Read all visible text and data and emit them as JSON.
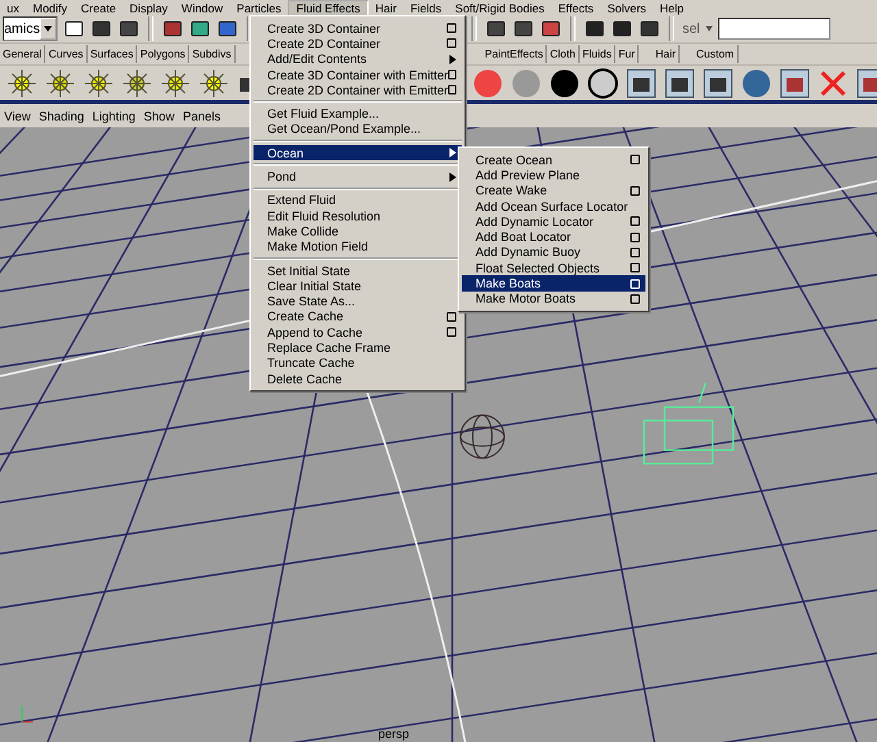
{
  "menu_bar": [
    {
      "label": "ux",
      "selected": false
    },
    {
      "label": "Modify",
      "selected": false
    },
    {
      "label": "Create",
      "selected": false
    },
    {
      "label": "Display",
      "selected": false
    },
    {
      "label": "Window",
      "selected": false
    },
    {
      "label": "Particles",
      "selected": false
    },
    {
      "label": "Fluid Effects",
      "selected": true
    },
    {
      "label": "Hair",
      "selected": false
    },
    {
      "label": "Fields",
      "selected": false
    },
    {
      "label": "Soft/Rigid Bodies",
      "selected": false
    },
    {
      "label": "Effects",
      "selected": false
    },
    {
      "label": "Solvers",
      "selected": false
    },
    {
      "label": "Help",
      "selected": false
    }
  ],
  "status_line": {
    "menu_set": "amics",
    "selection_mode": "sel"
  },
  "shelf_tabs": [
    "General",
    "Curves",
    "Surfaces",
    "Polygons",
    "Subdivs",
    "PaintEffects",
    "Cloth",
    "Fluids",
    "Fur",
    "Hair",
    "Custom"
  ],
  "panel_menu": [
    "View",
    "Shading",
    "Lighting",
    "Show",
    "Panels"
  ],
  "fluid_effects_menu": [
    [
      {
        "label": "Create 3D Container",
        "option_box": true,
        "submenu": false,
        "highlighted": false
      },
      {
        "label": "Create 2D Container",
        "option_box": true,
        "submenu": false,
        "highlighted": false
      },
      {
        "label": "Add/Edit Contents",
        "option_box": false,
        "submenu": true,
        "highlighted": false
      },
      {
        "label": "Create 3D Container with Emitter",
        "option_box": true,
        "submenu": false,
        "highlighted": false
      },
      {
        "label": "Create 2D Container with Emitter",
        "option_box": true,
        "submenu": false,
        "highlighted": false
      }
    ],
    [
      {
        "label": "Get Fluid Example...",
        "option_box": false,
        "submenu": false,
        "highlighted": false
      },
      {
        "label": "Get Ocean/Pond Example...",
        "option_box": false,
        "submenu": false,
        "highlighted": false
      }
    ],
    [
      {
        "label": "Ocean",
        "option_box": false,
        "submenu": true,
        "highlighted": true
      }
    ],
    [
      {
        "label": "Pond",
        "option_box": false,
        "submenu": true,
        "highlighted": false
      }
    ],
    [
      {
        "label": "Extend Fluid",
        "option_box": false,
        "submenu": false,
        "highlighted": false
      },
      {
        "label": "Edit Fluid Resolution",
        "option_box": false,
        "submenu": false,
        "highlighted": false
      },
      {
        "label": "Make Collide",
        "option_box": false,
        "submenu": false,
        "highlighted": false
      },
      {
        "label": "Make Motion Field",
        "option_box": false,
        "submenu": false,
        "highlighted": false
      }
    ],
    [
      {
        "label": "Set Initial State",
        "option_box": false,
        "submenu": false,
        "highlighted": false
      },
      {
        "label": "Clear Initial State",
        "option_box": false,
        "submenu": false,
        "highlighted": false
      },
      {
        "label": "Save State As...",
        "option_box": false,
        "submenu": false,
        "highlighted": false
      },
      {
        "label": "Create Cache",
        "option_box": true,
        "submenu": false,
        "highlighted": false
      },
      {
        "label": "Append to Cache",
        "option_box": true,
        "submenu": false,
        "highlighted": false
      },
      {
        "label": "Replace Cache Frame",
        "option_box": false,
        "submenu": false,
        "highlighted": false
      },
      {
        "label": "Truncate Cache",
        "option_box": false,
        "submenu": false,
        "highlighted": false
      },
      {
        "label": "Delete Cache",
        "option_box": false,
        "submenu": false,
        "highlighted": false
      }
    ]
  ],
  "ocean_menu": [
    {
      "label": "Create Ocean",
      "option_box": true,
      "highlighted": false
    },
    {
      "label": "Add Preview Plane",
      "option_box": false,
      "highlighted": false
    },
    {
      "label": "Create Wake",
      "option_box": true,
      "highlighted": false
    },
    {
      "label": "Add Ocean Surface Locator",
      "option_box": false,
      "highlighted": false
    },
    {
      "label": "Add Dynamic Locator",
      "option_box": true,
      "highlighted": false
    },
    {
      "label": "Add Boat Locator",
      "option_box": true,
      "highlighted": false
    },
    {
      "label": "Add Dynamic Buoy",
      "option_box": true,
      "highlighted": false
    },
    {
      "label": "Float Selected Objects",
      "option_box": true,
      "highlighted": false
    },
    {
      "label": "Make Boats",
      "option_box": true,
      "highlighted": true
    },
    {
      "label": "Make Motor Boats",
      "option_box": true,
      "highlighted": false
    }
  ],
  "viewport": {
    "camera": "persp"
  }
}
